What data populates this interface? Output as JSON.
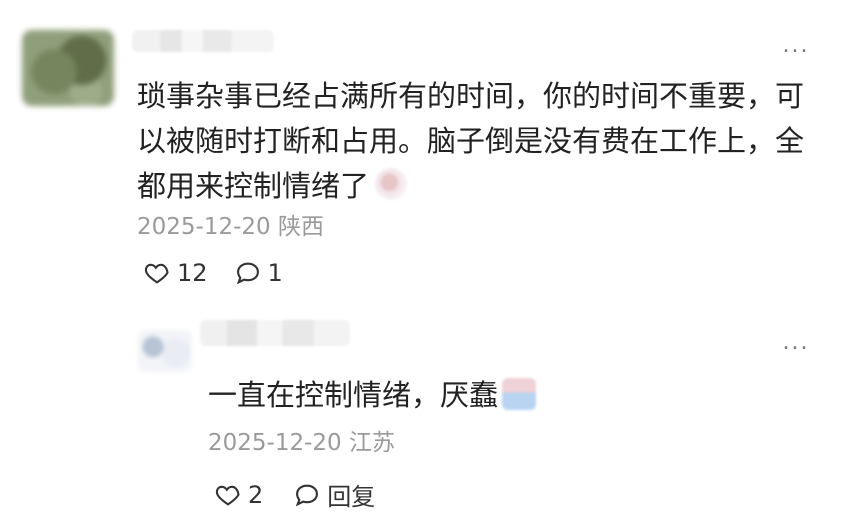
{
  "comment": {
    "text": "琐事杂事已经占满所有的时间，你的时间不重要，可以被随时打断和占用。脑子倒是没有费在工作上，全都用来控制情绪了",
    "date": "2025-12-20",
    "location": "陕西",
    "likes": "12",
    "replies": "1",
    "more_label": "..."
  },
  "reply": {
    "text": "一直在控制情绪，厌蠢",
    "date": "2025-12-20",
    "location": "江苏",
    "likes": "2",
    "reply_label": "回复",
    "more_label": "..."
  },
  "colors": {
    "text": "#222222",
    "meta": "#9a9a9a",
    "icon": "#333333"
  },
  "icons": [
    "heart-icon",
    "comment-bubble-icon",
    "more-dots-icon"
  ]
}
